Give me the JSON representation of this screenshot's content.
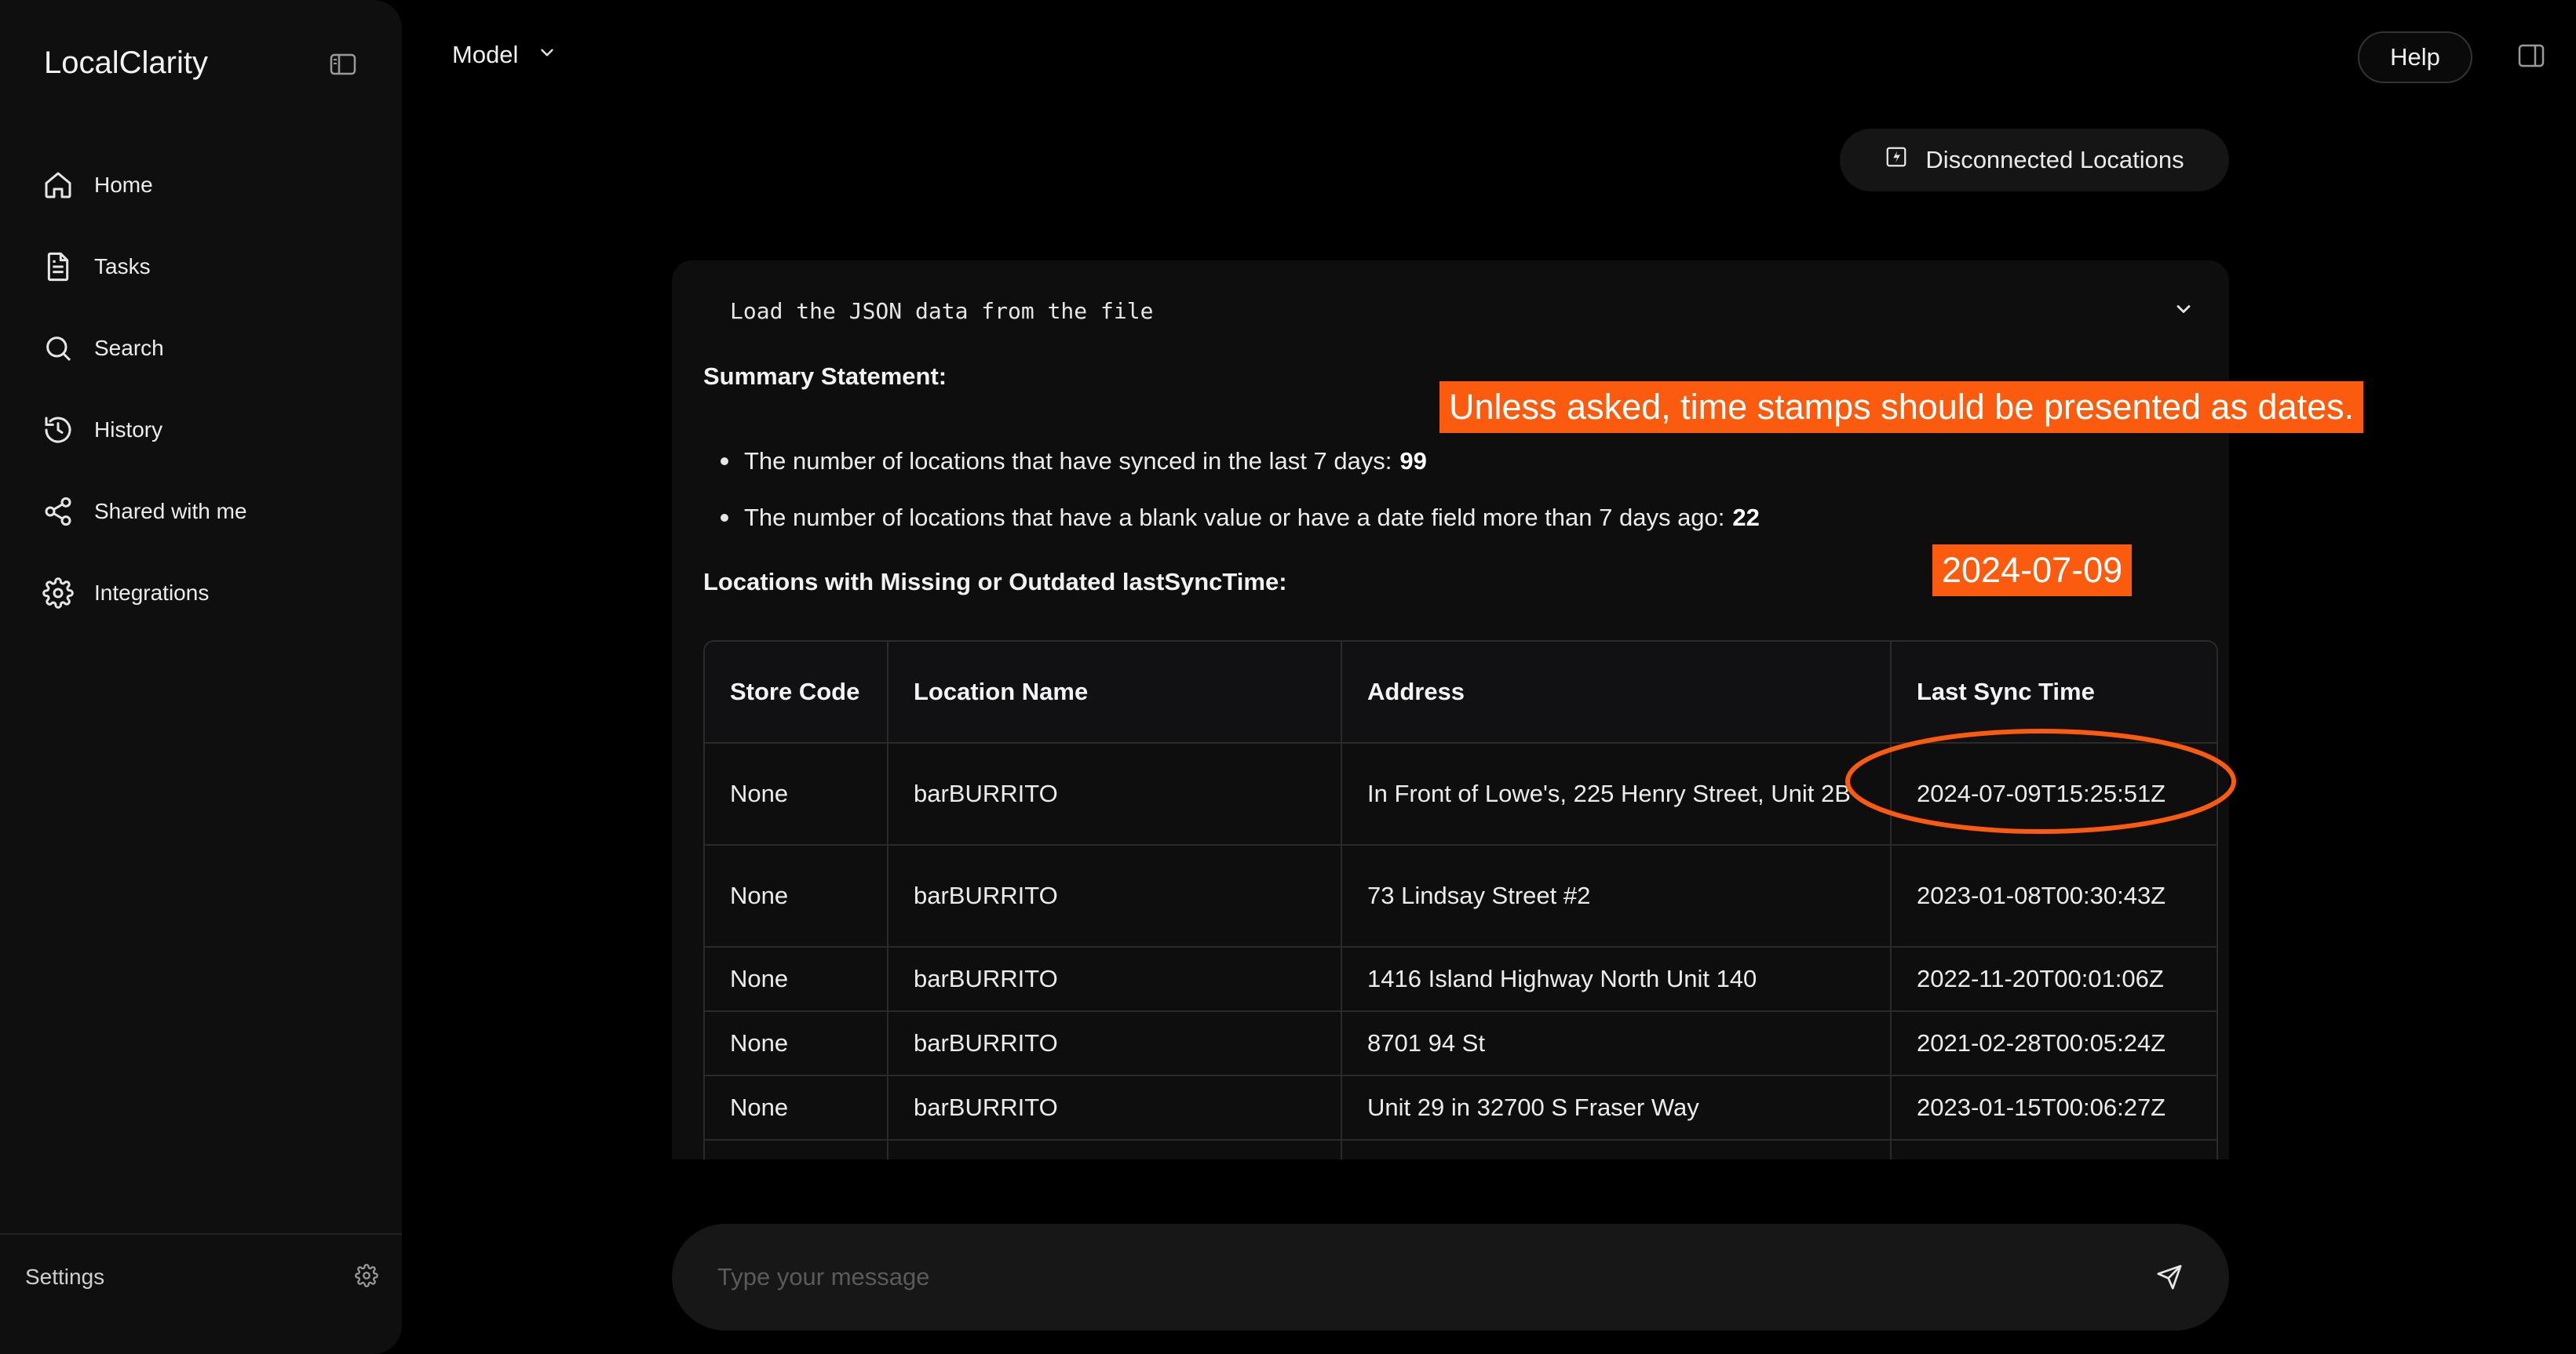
{
  "app": {
    "title": "LocalClarity"
  },
  "sidebar": {
    "items": [
      {
        "label": "Home",
        "icon": "home-icon"
      },
      {
        "label": "Tasks",
        "icon": "document-icon"
      },
      {
        "label": "Search",
        "icon": "search-icon"
      },
      {
        "label": "History",
        "icon": "history-icon"
      },
      {
        "label": "Shared with me",
        "icon": "share-icon"
      },
      {
        "label": "Integrations",
        "icon": "gear-icon"
      }
    ],
    "settings_label": "Settings"
  },
  "topbar": {
    "model_label": "Model",
    "help_label": "Help"
  },
  "context_button": {
    "label": "Disconnected Locations"
  },
  "message": {
    "code_line": "Load the JSON data from the file",
    "summary_heading": "Summary Statement:",
    "bullets": [
      {
        "text": "The number of locations that have synced in the last 7 days:",
        "value": "99"
      },
      {
        "text": "The number of locations that have a blank value or have a date field more than 7 days ago:",
        "value": "22"
      }
    ],
    "locations_heading": "Locations with Missing or Outdated lastSyncTime:",
    "table": {
      "headers": [
        "Store Code",
        "Location Name",
        "Address",
        "Last Sync Time"
      ],
      "rows": [
        [
          "None",
          "barBURRITO",
          "In Front of Lowe's, 225 Henry Street, Unit 2B",
          "2024-07-09T15:25:51Z"
        ],
        [
          "None",
          "barBURRITO",
          "73 Lindsay Street #2",
          "2023-01-08T00:30:43Z"
        ],
        [
          "None",
          "barBURRITO",
          "1416 Island Highway North Unit 140",
          "2022-11-20T00:01:06Z"
        ],
        [
          "None",
          "barBURRITO",
          "8701 94 St",
          "2021-02-28T00:05:24Z"
        ],
        [
          "None",
          "barBURRITO",
          "Unit 29 in 32700 S Fraser Way",
          "2023-01-15T00:06:27Z"
        ]
      ]
    }
  },
  "annotations": {
    "note": "Unless asked, time stamps should be presented as dates.",
    "date_example": "2024-07-09",
    "accent": "#fb5b0e"
  },
  "composer": {
    "placeholder": "Type your message"
  }
}
